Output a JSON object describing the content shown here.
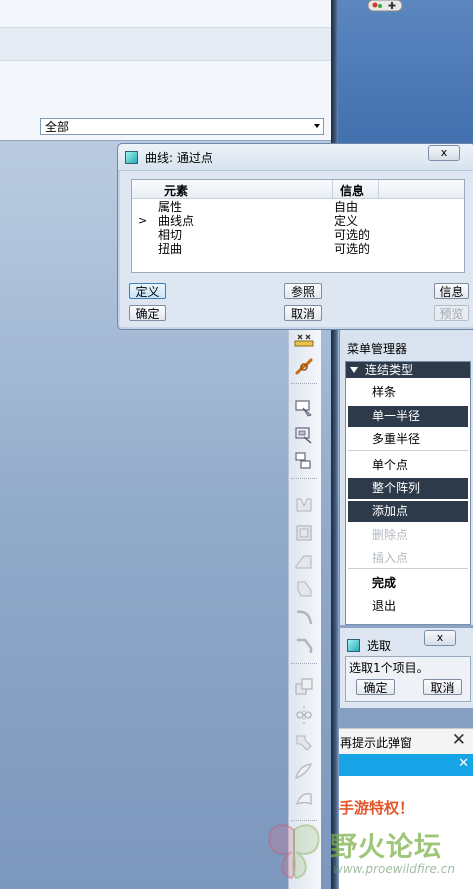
{
  "top_panel": {
    "filter_value": "全部"
  },
  "curve_dialog": {
    "title": "曲线: 通过点",
    "close_label": "x",
    "table": {
      "columns": [
        "元素",
        "信息"
      ],
      "rows": [
        {
          "element": "属性",
          "info": "自由",
          "current": false
        },
        {
          "element": "曲线点",
          "info": "定义",
          "current": true
        },
        {
          "element": "相切",
          "info": "可选的",
          "current": false
        },
        {
          "element": "扭曲",
          "info": "可选的",
          "current": false
        }
      ]
    },
    "buttons": {
      "define": "定义",
      "ok": "确定",
      "reference": "参照",
      "cancel": "取消",
      "info": "信息",
      "preview": "预览"
    }
  },
  "menu_manager": {
    "title": "菜单管理器",
    "header": "连结类型",
    "items": [
      {
        "label": "样条",
        "state": "normal"
      },
      {
        "label": "单一半径",
        "state": "selected"
      },
      {
        "label": "多重半径",
        "state": "normal"
      },
      {
        "label": "单个点",
        "state": "normal"
      },
      {
        "label": "整个阵列",
        "state": "selected"
      },
      {
        "label": "添加点",
        "state": "selected"
      },
      {
        "label": "删除点",
        "state": "disabled"
      },
      {
        "label": "插入点",
        "state": "disabled"
      },
      {
        "label": "完成",
        "state": "bold"
      },
      {
        "label": "退出",
        "state": "normal"
      }
    ]
  },
  "select_dialog": {
    "title": "选取",
    "close_label": "x",
    "status": "选取1个项目。",
    "ok": "确定",
    "cancel": "取消"
  },
  "ad": {
    "bar_text": "再提示此弹窗",
    "close_label": "✕",
    "promo_text": "手游特权！"
  },
  "watermark": {
    "name": "野火论坛",
    "url": "www.proewildfire.cn"
  },
  "colors": {
    "menu_selected_bg": "#2d3a4a",
    "dialog_bg": "#dde6f1",
    "ad_blue": "#16a4e6",
    "promo_orange": "#e2562a"
  }
}
